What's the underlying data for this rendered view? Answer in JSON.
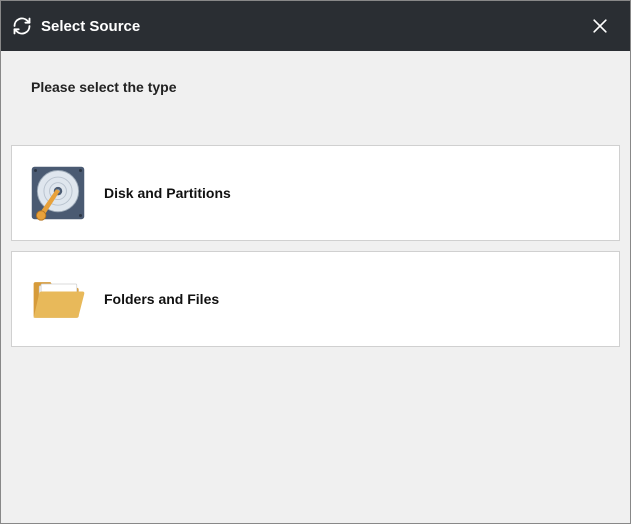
{
  "titlebar": {
    "title": "Select Source"
  },
  "prompt": "Please select the type",
  "options": {
    "disk": {
      "label": "Disk and Partitions"
    },
    "folders": {
      "label": "Folders and Files"
    }
  }
}
